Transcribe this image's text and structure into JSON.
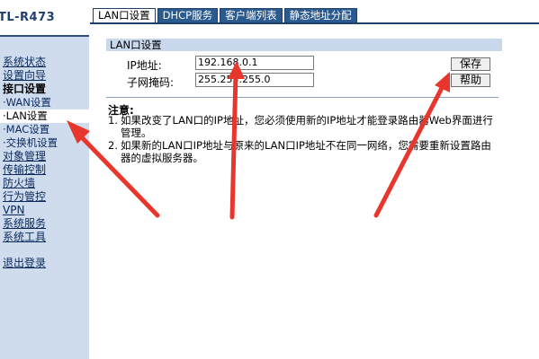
{
  "brand": "TL-R473",
  "sidebar": {
    "items": [
      {
        "label": "系统状态",
        "style": "link"
      },
      {
        "label": "设置向导",
        "style": "link"
      },
      {
        "label": "接口设置",
        "style": "bold"
      },
      {
        "label": "·WAN设置",
        "style": "sub"
      },
      {
        "label": "·LAN设置",
        "style": "sub active"
      },
      {
        "label": "·MAC设置",
        "style": "sub"
      },
      {
        "label": "·交换机设置",
        "style": "sub"
      },
      {
        "label": "对象管理",
        "style": "link"
      },
      {
        "label": "传输控制",
        "style": "link"
      },
      {
        "label": "防火墙",
        "style": "link"
      },
      {
        "label": "行为管控",
        "style": "link"
      },
      {
        "label": "VPN",
        "style": "link"
      },
      {
        "label": "系统服务",
        "style": "link"
      },
      {
        "label": "系统工具",
        "style": "link"
      }
    ],
    "logout": "退出登录"
  },
  "tabs": [
    {
      "label": "LAN口设置",
      "active": true
    },
    {
      "label": "DHCP服务",
      "active": false
    },
    {
      "label": "客户端列表",
      "active": false
    },
    {
      "label": "静态地址分配",
      "active": false
    }
  ],
  "panel": {
    "title": "LAN口设置",
    "ip_label": "IP地址:",
    "ip_value": "192.168.0.1",
    "mask_label": "子网掩码:",
    "mask_value": "255.255.255.0",
    "save_label": "保存",
    "help_label": "帮助"
  },
  "notes": {
    "title": "注意:",
    "items": [
      {
        "num": "1.",
        "text": "如果改变了LAN口的IP地址，您必须使用新的IP地址才能登录路由器Web界面进行管理。"
      },
      {
        "num": "2.",
        "text": "如果新的LAN口IP地址与原来的LAN口IP地址不在同一网络，您需要重新设置路由器的虚拟服务器。"
      }
    ]
  },
  "colors": {
    "sidebar_bg": "#cfdcee",
    "tab_bg": "#2b5a8e",
    "panel_title_bg": "#c9d8ec",
    "arrow_red": "#e8362c"
  }
}
